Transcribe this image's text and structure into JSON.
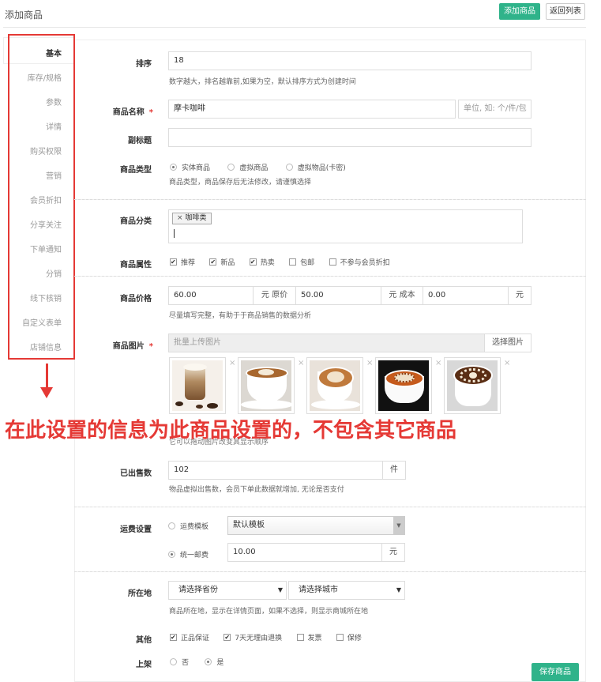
{
  "header": {
    "title": "添加商品",
    "add_button": "添加商品",
    "back_button": "返回列表"
  },
  "sidebar": {
    "items": [
      {
        "label": "基本"
      },
      {
        "label": "库存/规格"
      },
      {
        "label": "参数"
      },
      {
        "label": "详情"
      },
      {
        "label": "购买权限"
      },
      {
        "label": "营销"
      },
      {
        "label": "会员折扣"
      },
      {
        "label": "分享关注"
      },
      {
        "label": "下单通知"
      },
      {
        "label": "分销"
      },
      {
        "label": "线下核销"
      },
      {
        "label": "自定义表单"
      },
      {
        "label": "店铺信息"
      }
    ]
  },
  "annotation": {
    "banner": "在此设置的信息为此商品设置的，不包含其它商品",
    "accent": "#e53935"
  },
  "form": {
    "sort": {
      "label": "排序",
      "value": "18",
      "hint": "数字越大，排名越靠前,如果为空，默认排序方式为创建时间"
    },
    "name": {
      "label": "商品名称",
      "required": "*",
      "value": "摩卡咖啡",
      "unit_placeholder": "单位, 如: 个/件/包"
    },
    "subtitle": {
      "label": "副标题",
      "value": ""
    },
    "type": {
      "label": "商品类型",
      "options": [
        "实体商品",
        "虚拟商品",
        "虚拟物品(卡密)"
      ],
      "selected": "实体商品",
      "hint": "商品类型，商品保存后无法修改，请谨慎选择"
    },
    "category": {
      "label": "商品分类",
      "tag": "咖啡类",
      "tag_remove": "×"
    },
    "attributes": {
      "label": "商品属性",
      "options": [
        {
          "label": "推荐",
          "checked": true
        },
        {
          "label": "新品",
          "checked": true
        },
        {
          "label": "热卖",
          "checked": true
        },
        {
          "label": "包邮",
          "checked": false
        },
        {
          "label": "不参与会员折扣",
          "checked": false
        }
      ]
    },
    "price": {
      "label": "商品价格",
      "price": "60.00",
      "price_unit": "元 原价",
      "original": "50.00",
      "original_unit": "元 成本",
      "cost": "0.00",
      "cost_unit": "元",
      "hint": "尽量填写完整，有助于于商品销售的数据分析"
    },
    "images": {
      "label": "商品图片",
      "required": "*",
      "placeholder": "批量上传图片",
      "select_button": "选择图片",
      "hint_tail": "它可以拖动图片改变其显示顺序",
      "remove": "×"
    },
    "sold": {
      "label": "已出售数",
      "value": "102",
      "unit": "件",
      "hint": "物品虚拟出售数，会员下单此数据就增加, 无论是否支付"
    },
    "shipping": {
      "label": "运费设置",
      "template_option": "运费模板",
      "template_value": "默认模板",
      "flat_option": "统一邮费",
      "flat_value": "10.00",
      "flat_unit": "元",
      "selected": "统一邮费"
    },
    "location": {
      "label": "所在地",
      "province": "请选择省份",
      "city": "请选择城市",
      "hint": "商品所在地，显示在详情页面，如果不选择，则显示商城所在地"
    },
    "other": {
      "label": "其他",
      "options": [
        {
          "label": "正品保证",
          "checked": true
        },
        {
          "label": "7天无理由退换",
          "checked": true
        },
        {
          "label": "发票",
          "checked": false
        },
        {
          "label": "保修",
          "checked": false
        }
      ]
    },
    "onsale": {
      "label": "上架",
      "options": [
        "否",
        "是"
      ],
      "selected": "是"
    },
    "save_button": "保存商品"
  },
  "colors": {
    "primary": "#2fb38a",
    "annotation_red": "#e53935"
  }
}
